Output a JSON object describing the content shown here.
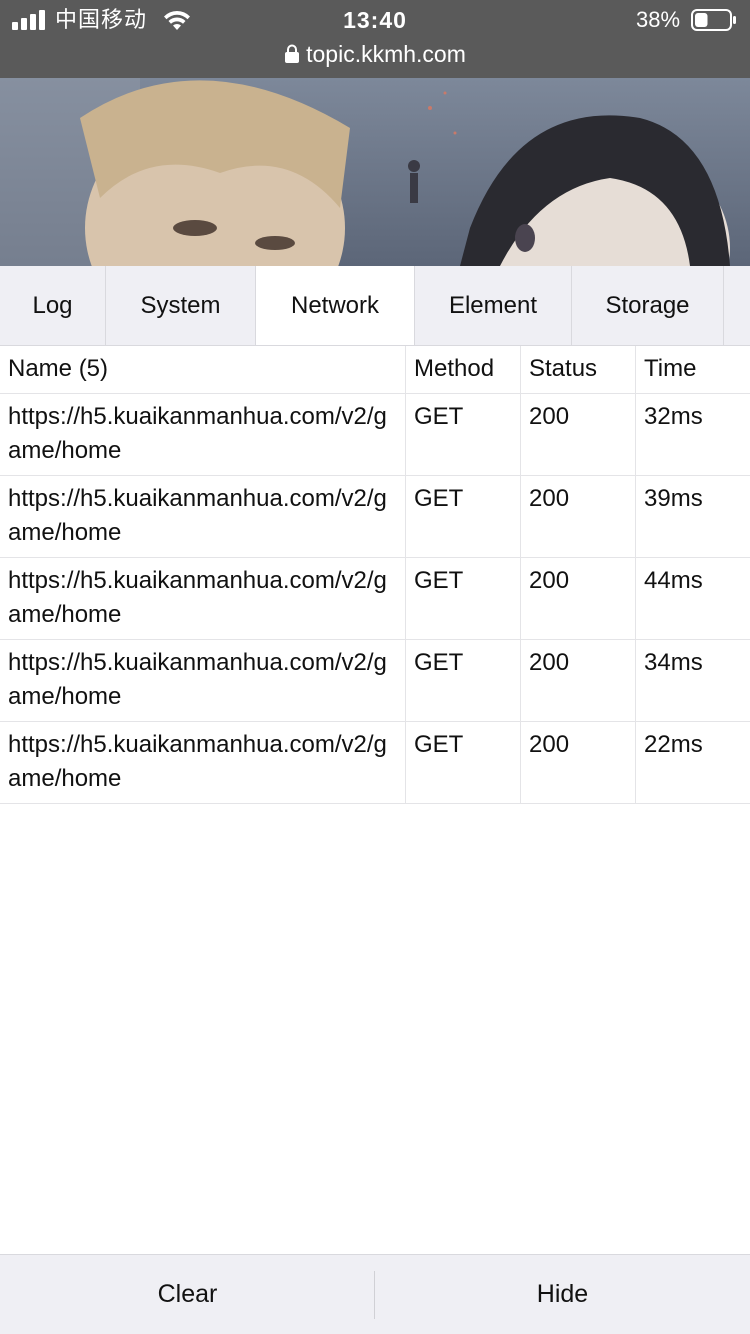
{
  "status_bar": {
    "carrier": "中国移动",
    "time": "13:40",
    "battery": "38%",
    "battery_level": 0.38
  },
  "browser": {
    "url": "topic.kkmh.com"
  },
  "tabs": [
    {
      "label": "Log",
      "active": false
    },
    {
      "label": "System",
      "active": false
    },
    {
      "label": "Network",
      "active": true
    },
    {
      "label": "Element",
      "active": false
    },
    {
      "label": "Storage",
      "active": false
    }
  ],
  "network": {
    "columns": {
      "name": "Name (5)",
      "method": "Method",
      "status": "Status",
      "time": "Time"
    },
    "rows": [
      {
        "name": "https://h5.kuaikanmanhua.com/v2/game/home",
        "method": "GET",
        "status": "200",
        "time": "32ms"
      },
      {
        "name": "https://h5.kuaikanmanhua.com/v2/game/home",
        "method": "GET",
        "status": "200",
        "time": "39ms"
      },
      {
        "name": "https://h5.kuaikanmanhua.com/v2/game/home",
        "method": "GET",
        "status": "200",
        "time": "44ms"
      },
      {
        "name": "https://h5.kuaikanmanhua.com/v2/game/home",
        "method": "GET",
        "status": "200",
        "time": "34ms"
      },
      {
        "name": "https://h5.kuaikanmanhua.com/v2/game/home",
        "method": "GET",
        "status": "200",
        "time": "22ms"
      }
    ]
  },
  "toolbar": {
    "clear_label": "Clear",
    "hide_label": "Hide"
  }
}
